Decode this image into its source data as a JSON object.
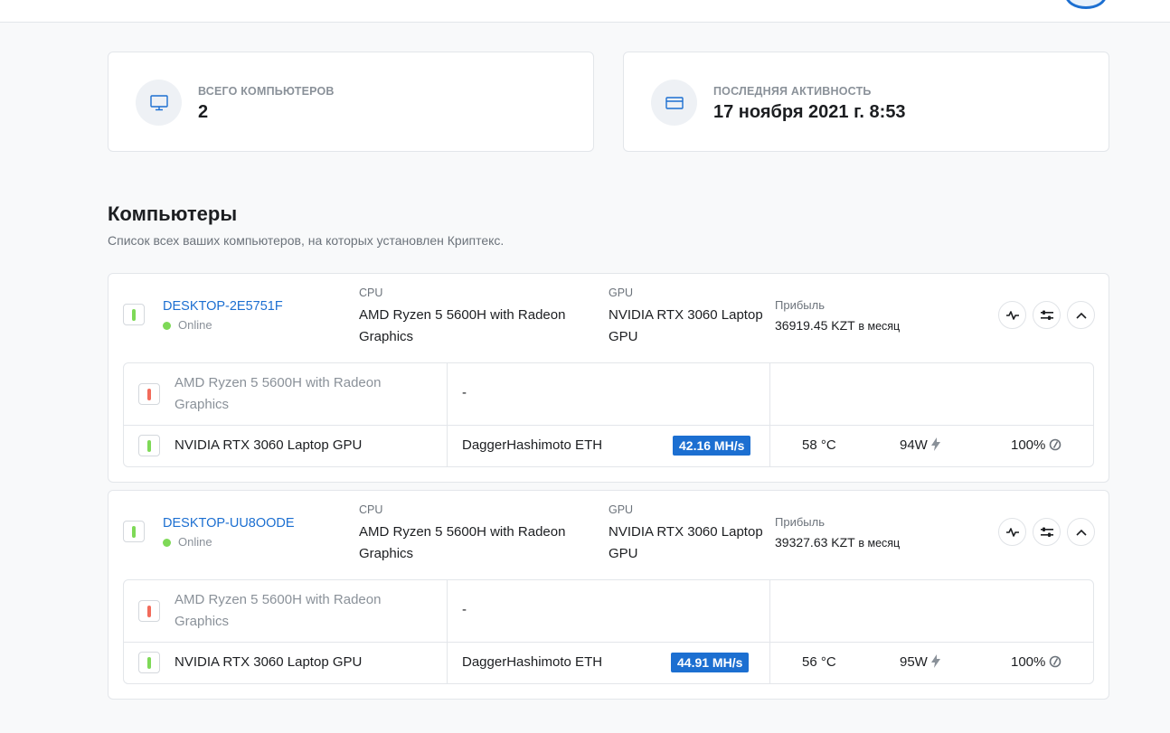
{
  "stats": [
    {
      "label": "ВСЕГО КОМПЬЮТЕРОВ",
      "value": "2",
      "icon": "monitor-icon"
    },
    {
      "label": "ПОСЛЕДНЯЯ АКТИВНОСТЬ",
      "value": "17 ноября 2021 г. 8:53",
      "icon": "credit-card-icon"
    }
  ],
  "section": {
    "title": "Компьютеры",
    "subtitle": "Список всех ваших компьютеров, на которых установлен Криптекс."
  },
  "computers": [
    {
      "name": "DESKTOP-2E5751F",
      "status": "Online",
      "cpu_label": "CPU",
      "cpu": "AMD Ryzen 5 5600H with Radeon Graphics",
      "gpu_label": "GPU",
      "gpu": "NVIDIA RTX 3060 Laptop GPU",
      "profit_label": "Прибыль",
      "profit": "36919.45 KZT",
      "profit_unit": "в месяц",
      "devices": [
        {
          "name": "AMD Ryzen 5 5600H with Radeon Graphics",
          "algo": "-",
          "enabled": false
        },
        {
          "name": "NVIDIA RTX 3060 Laptop GPU",
          "algo": "DaggerHashimoto ETH",
          "hashrate": "42.16 MH/s",
          "temp": "58 °C",
          "power": "94W",
          "load": "100%",
          "enabled": true
        }
      ]
    },
    {
      "name": "DESKTOP-UU8OODE",
      "status": "Online",
      "cpu_label": "CPU",
      "cpu": "AMD Ryzen 5 5600H with Radeon Graphics",
      "gpu_label": "GPU",
      "gpu": "NVIDIA RTX 3060 Laptop GPU",
      "profit_label": "Прибыль",
      "profit": "39327.63 KZT",
      "profit_unit": "в месяц",
      "devices": [
        {
          "name": "AMD Ryzen 5 5600H with Radeon Graphics",
          "algo": "-",
          "enabled": false
        },
        {
          "name": "NVIDIA RTX 3060 Laptop GPU",
          "algo": "DaggerHashimoto ETH",
          "hashrate": "44.91 MH/s",
          "temp": "56 °C",
          "power": "95W",
          "load": "100%",
          "enabled": true
        }
      ]
    }
  ],
  "colors": {
    "accent": "#1c6fd1",
    "online": "#7ed957",
    "disabled": "#f26b5b"
  }
}
